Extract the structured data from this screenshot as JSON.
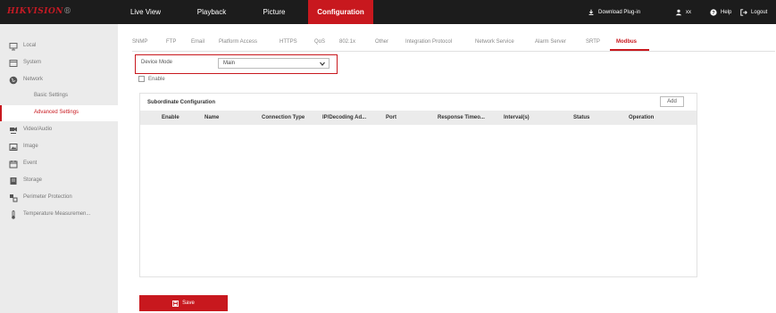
{
  "header": {
    "logo_main": "HIKVISION",
    "logo_rest": "®",
    "nav": [
      "Live View",
      "Playback",
      "Picture",
      "Configuration"
    ],
    "active_nav": "Configuration",
    "right": {
      "download_plugin": "Download Plug-in",
      "user": "xx",
      "help": "Help",
      "logout": "Logout"
    }
  },
  "sidebar": {
    "items": [
      {
        "label": "Local",
        "icon": "monitor-icon"
      },
      {
        "label": "System",
        "icon": "system-icon"
      },
      {
        "label": "Network",
        "icon": "globe-icon"
      },
      {
        "label": "Basic Settings",
        "sub": true
      },
      {
        "label": "Advanced Settings",
        "sub": true,
        "active": true
      },
      {
        "label": "Video/Audio",
        "icon": "video-audio-icon"
      },
      {
        "label": "Image",
        "icon": "image-icon"
      },
      {
        "label": "Event",
        "icon": "calendar-icon"
      },
      {
        "label": "Storage",
        "icon": "storage-icon"
      },
      {
        "label": "Perimeter Protection",
        "icon": "perimeter-icon"
      },
      {
        "label": "Temperature Measuremen...",
        "icon": "thermometer-icon"
      }
    ]
  },
  "subtabs": [
    "SNMP",
    "FTP",
    "Email",
    "Platform Access",
    "HTTPS",
    "QoS",
    "802.1x",
    "Other",
    "Integration Protocol",
    "Network Service",
    "Alarm Server",
    "SRTP",
    "Modbus"
  ],
  "active_subtab": "Modbus",
  "device_mode": {
    "label": "Device Mode",
    "value": "Main"
  },
  "enable_label": "Enable",
  "subordinate": {
    "title": "Subordinate Configuration",
    "add_label": "Add",
    "columns": [
      "Enable",
      "Name",
      "Connection Type",
      "IP/Decoding Ad...",
      "Port",
      "Response Timeo...",
      "Interval(s)",
      "Status",
      "Operation"
    ],
    "rows": []
  },
  "save_label": "Save",
  "colors": {
    "accent": "#c8181e",
    "topbar": "#1c1c1c",
    "sidebar": "#ebebeb"
  }
}
